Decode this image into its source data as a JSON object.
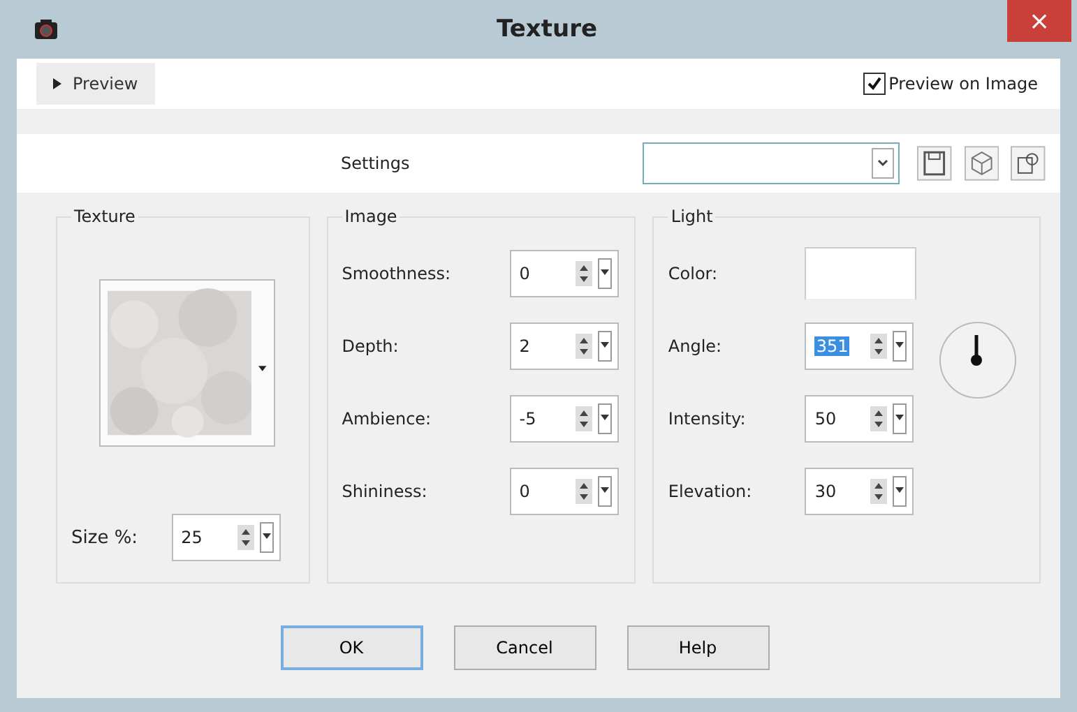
{
  "window": {
    "title": "Texture",
    "close": "×"
  },
  "preview_toggle": {
    "label": "Preview",
    "expanded": false
  },
  "preview_on_image": {
    "label": "Preview on Image",
    "checked": true
  },
  "settings": {
    "label": "Settings"
  },
  "texture_group": {
    "title": "Texture",
    "size": {
      "label": "Size %:",
      "value": "25"
    }
  },
  "image_group": {
    "title": "Image",
    "fields": [
      {
        "label": "Smoothness:",
        "value": "0",
        "selected": false
      },
      {
        "label": "Depth:",
        "value": "2",
        "selected": false
      },
      {
        "label": "Ambience:",
        "value": "-5",
        "selected": false
      },
      {
        "label": "Shininess:",
        "value": "0",
        "selected": false
      }
    ]
  },
  "light_group": {
    "title": "Light",
    "color": {
      "label": "Color:",
      "color": "#ffffff"
    },
    "fields": [
      {
        "label": "Angle:",
        "value": "351",
        "selected": true
      },
      {
        "label": "Intensity:",
        "value": "50",
        "selected": false
      },
      {
        "label": "Elevation:",
        "value": "30",
        "selected": false
      }
    ]
  },
  "buttons": [
    {
      "label": "OK",
      "default": true
    },
    {
      "label": "Cancel",
      "default": false
    },
    {
      "label": "Help",
      "default": false
    }
  ]
}
